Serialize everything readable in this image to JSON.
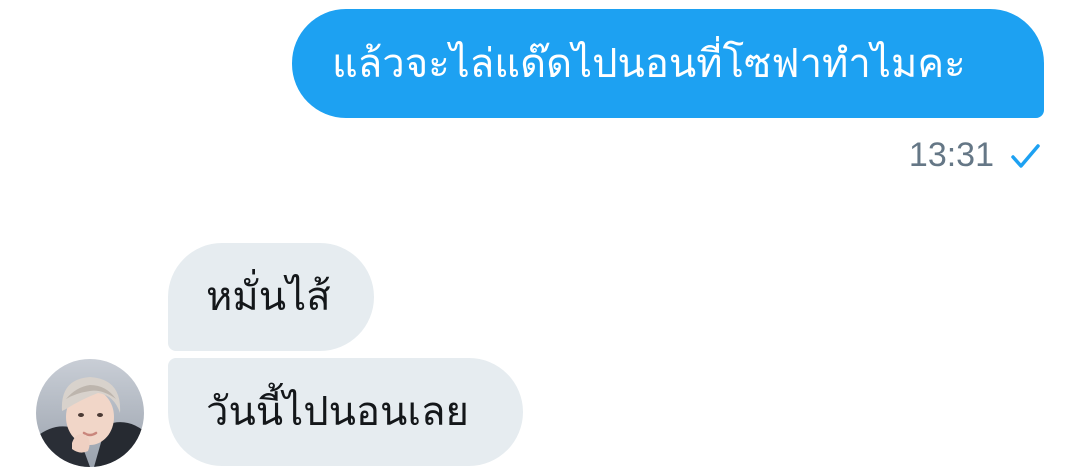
{
  "conversation": {
    "outgoing": {
      "text": "แล้วจะไล่แด๊ดไปนอนที่โซฟาทำไมคะ",
      "timestamp": "13:31",
      "status_icon": "check-icon"
    },
    "incoming": [
      {
        "text": "หมั่นไส้"
      },
      {
        "text": "วันนี้ไปนอนเลย"
      }
    ],
    "avatar_icon": "user-avatar"
  },
  "colors": {
    "outgoing_bubble": "#1da1f2",
    "incoming_bubble": "#e6ecf0",
    "timestamp": "#657786",
    "check": "#1da1f2"
  }
}
